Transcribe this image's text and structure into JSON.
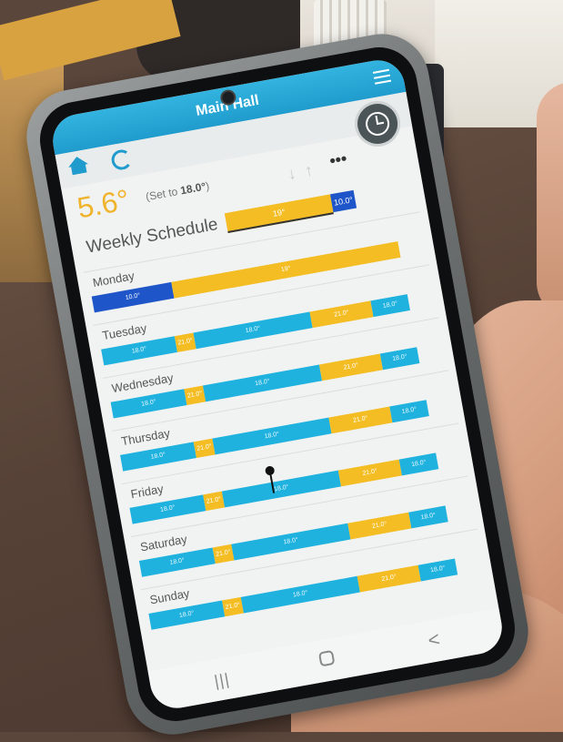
{
  "app": {
    "title": "Main Hall",
    "current_temp": "5.6°",
    "set_to_prefix": "(Set to ",
    "set_to_value": "18.0°",
    "set_to_suffix": ")",
    "more_glyph": "•••",
    "arrows_glyph": "↓↑"
  },
  "schedule": {
    "title": "Weekly Schedule",
    "header_bar": [
      {
        "label": "19°",
        "kind": "warm"
      },
      {
        "label": "10.0°",
        "kind": "night"
      }
    ],
    "days": [
      {
        "name": "Monday",
        "segments": [
          {
            "label": "10.0°",
            "kind": "night"
          },
          {
            "label": "19°",
            "kind": "warm"
          }
        ]
      },
      {
        "name": "Tuesday",
        "segments": [
          {
            "label": "18.0°",
            "kind": "cool"
          },
          {
            "label": "21.0°",
            "kind": "warm"
          },
          {
            "label": "18.0°",
            "kind": "cool"
          },
          {
            "label": "21.0°",
            "kind": "warm"
          },
          {
            "label": "18.0°",
            "kind": "cool"
          }
        ]
      },
      {
        "name": "Wednesday",
        "segments": [
          {
            "label": "18.0°",
            "kind": "cool"
          },
          {
            "label": "21.0°",
            "kind": "warm"
          },
          {
            "label": "18.0°",
            "kind": "cool"
          },
          {
            "label": "21.0°",
            "kind": "warm"
          },
          {
            "label": "18.0°",
            "kind": "cool"
          }
        ]
      },
      {
        "name": "Thursday",
        "segments": [
          {
            "label": "18.0°",
            "kind": "cool"
          },
          {
            "label": "21.0°",
            "kind": "warm"
          },
          {
            "label": "18.0°",
            "kind": "cool"
          },
          {
            "label": "21.0°",
            "kind": "warm"
          },
          {
            "label": "18.0°",
            "kind": "cool"
          }
        ]
      },
      {
        "name": "Friday",
        "segments": [
          {
            "label": "18.0°",
            "kind": "cool"
          },
          {
            "label": "21.0°",
            "kind": "warm"
          },
          {
            "label": "18.0°",
            "kind": "cool"
          },
          {
            "label": "21.0°",
            "kind": "warm"
          },
          {
            "label": "18.0°",
            "kind": "cool"
          }
        ]
      },
      {
        "name": "Saturday",
        "segments": [
          {
            "label": "18.0°",
            "kind": "cool"
          },
          {
            "label": "21.0°",
            "kind": "warm"
          },
          {
            "label": "18.0°",
            "kind": "cool"
          },
          {
            "label": "21.0°",
            "kind": "warm"
          },
          {
            "label": "18.0°",
            "kind": "cool"
          }
        ]
      },
      {
        "name": "Sunday",
        "segments": [
          {
            "label": "18.0°",
            "kind": "cool"
          },
          {
            "label": "21.0°",
            "kind": "warm"
          },
          {
            "label": "18.0°",
            "kind": "cool"
          },
          {
            "label": "21.0°",
            "kind": "warm"
          },
          {
            "label": "18.0°",
            "kind": "cool"
          }
        ]
      }
    ]
  },
  "icons": {
    "home": "home-icon",
    "refresh": "refresh-icon",
    "clock": "clock-settings-icon",
    "menu": "hamburger-menu-icon"
  },
  "colors": {
    "header": "#1f9ccd",
    "cool": "#1fb2df",
    "warm": "#f4bd23",
    "night": "#1e56c9",
    "temp": "#f0b32c"
  },
  "nav": {
    "recent": "|||",
    "back": "<"
  }
}
